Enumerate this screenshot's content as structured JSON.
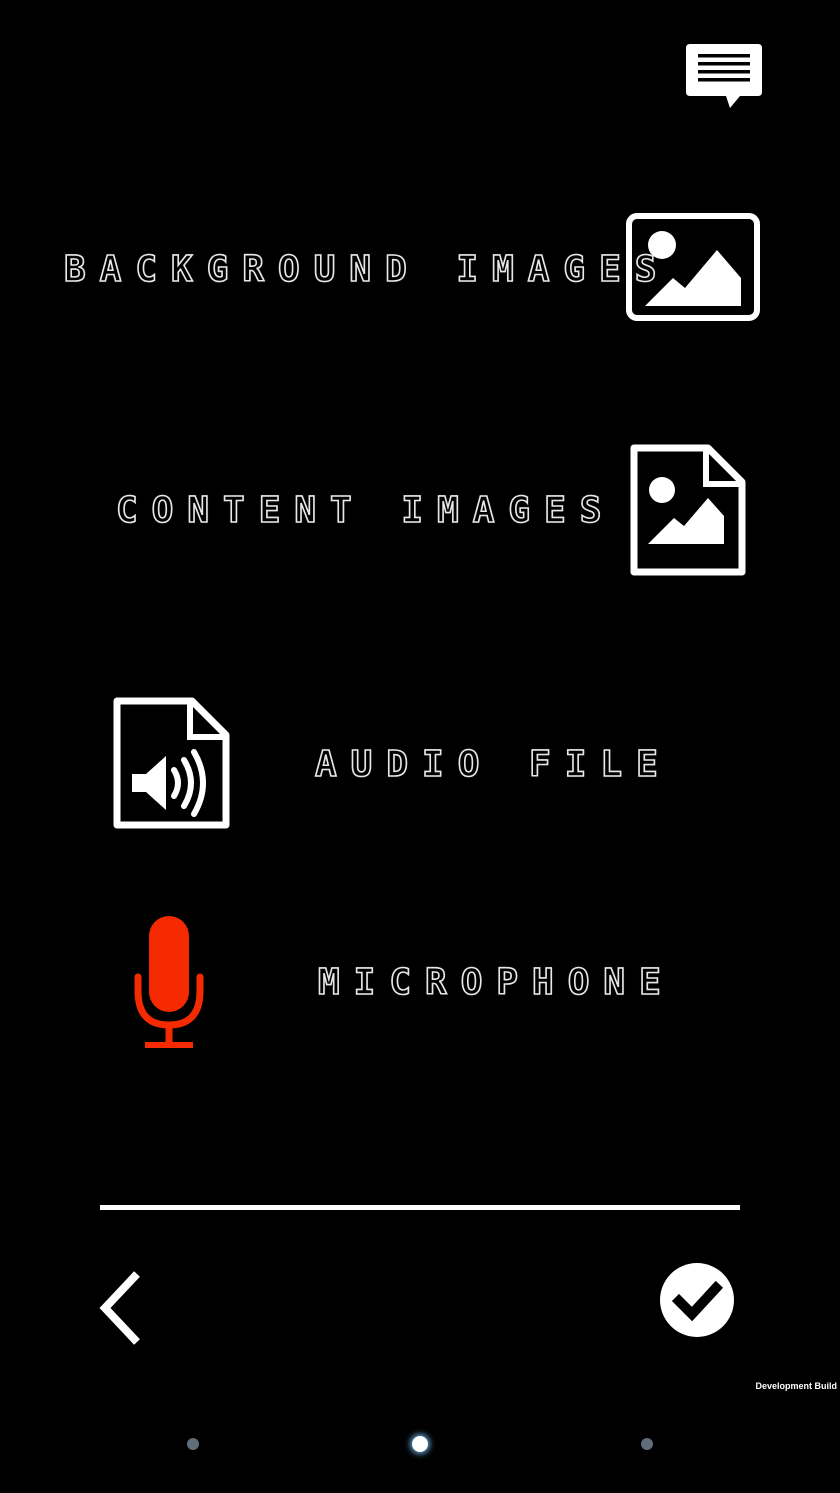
{
  "options": {
    "background_images": {
      "label": "BACKGROUND IMAGES",
      "icon": "image-frame-icon"
    },
    "content_images": {
      "label": "CONTENT IMAGES",
      "icon": "image-file-icon"
    },
    "audio_file": {
      "label": "AUDIO FILE",
      "icon": "audio-file-icon"
    },
    "microphone": {
      "label": "MICROPHONE",
      "icon": "microphone-icon",
      "color": "#f52a00"
    }
  },
  "header": {
    "icon": "chat-bubble-icon"
  },
  "footer": {
    "back_icon": "chevron-left-icon",
    "confirm_icon": "checkmark-circle-icon"
  },
  "build_label": "Development Build",
  "pagination": {
    "total": 3,
    "active": 2
  }
}
